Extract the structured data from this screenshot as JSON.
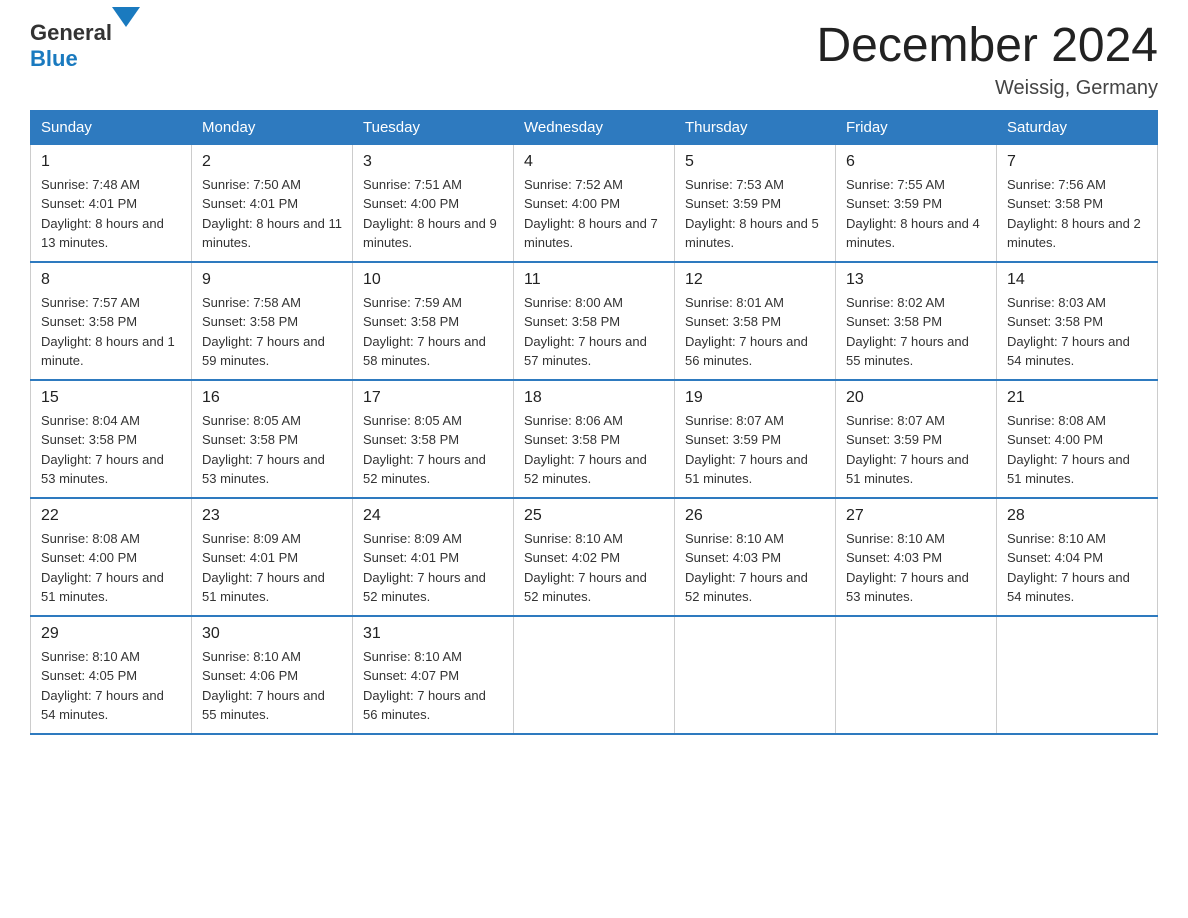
{
  "header": {
    "logo_general": "General",
    "logo_blue": "Blue",
    "month_title": "December 2024",
    "location": "Weissig, Germany"
  },
  "days_of_week": [
    "Sunday",
    "Monday",
    "Tuesday",
    "Wednesday",
    "Thursday",
    "Friday",
    "Saturday"
  ],
  "weeks": [
    [
      {
        "day": "1",
        "sunrise": "7:48 AM",
        "sunset": "4:01 PM",
        "daylight": "8 hours and 13 minutes."
      },
      {
        "day": "2",
        "sunrise": "7:50 AM",
        "sunset": "4:01 PM",
        "daylight": "8 hours and 11 minutes."
      },
      {
        "day": "3",
        "sunrise": "7:51 AM",
        "sunset": "4:00 PM",
        "daylight": "8 hours and 9 minutes."
      },
      {
        "day": "4",
        "sunrise": "7:52 AM",
        "sunset": "4:00 PM",
        "daylight": "8 hours and 7 minutes."
      },
      {
        "day": "5",
        "sunrise": "7:53 AM",
        "sunset": "3:59 PM",
        "daylight": "8 hours and 5 minutes."
      },
      {
        "day": "6",
        "sunrise": "7:55 AM",
        "sunset": "3:59 PM",
        "daylight": "8 hours and 4 minutes."
      },
      {
        "day": "7",
        "sunrise": "7:56 AM",
        "sunset": "3:58 PM",
        "daylight": "8 hours and 2 minutes."
      }
    ],
    [
      {
        "day": "8",
        "sunrise": "7:57 AM",
        "sunset": "3:58 PM",
        "daylight": "8 hours and 1 minute."
      },
      {
        "day": "9",
        "sunrise": "7:58 AM",
        "sunset": "3:58 PM",
        "daylight": "7 hours and 59 minutes."
      },
      {
        "day": "10",
        "sunrise": "7:59 AM",
        "sunset": "3:58 PM",
        "daylight": "7 hours and 58 minutes."
      },
      {
        "day": "11",
        "sunrise": "8:00 AM",
        "sunset": "3:58 PM",
        "daylight": "7 hours and 57 minutes."
      },
      {
        "day": "12",
        "sunrise": "8:01 AM",
        "sunset": "3:58 PM",
        "daylight": "7 hours and 56 minutes."
      },
      {
        "day": "13",
        "sunrise": "8:02 AM",
        "sunset": "3:58 PM",
        "daylight": "7 hours and 55 minutes."
      },
      {
        "day": "14",
        "sunrise": "8:03 AM",
        "sunset": "3:58 PM",
        "daylight": "7 hours and 54 minutes."
      }
    ],
    [
      {
        "day": "15",
        "sunrise": "8:04 AM",
        "sunset": "3:58 PM",
        "daylight": "7 hours and 53 minutes."
      },
      {
        "day": "16",
        "sunrise": "8:05 AM",
        "sunset": "3:58 PM",
        "daylight": "7 hours and 53 minutes."
      },
      {
        "day": "17",
        "sunrise": "8:05 AM",
        "sunset": "3:58 PM",
        "daylight": "7 hours and 52 minutes."
      },
      {
        "day": "18",
        "sunrise": "8:06 AM",
        "sunset": "3:58 PM",
        "daylight": "7 hours and 52 minutes."
      },
      {
        "day": "19",
        "sunrise": "8:07 AM",
        "sunset": "3:59 PM",
        "daylight": "7 hours and 51 minutes."
      },
      {
        "day": "20",
        "sunrise": "8:07 AM",
        "sunset": "3:59 PM",
        "daylight": "7 hours and 51 minutes."
      },
      {
        "day": "21",
        "sunrise": "8:08 AM",
        "sunset": "4:00 PM",
        "daylight": "7 hours and 51 minutes."
      }
    ],
    [
      {
        "day": "22",
        "sunrise": "8:08 AM",
        "sunset": "4:00 PM",
        "daylight": "7 hours and 51 minutes."
      },
      {
        "day": "23",
        "sunrise": "8:09 AM",
        "sunset": "4:01 PM",
        "daylight": "7 hours and 51 minutes."
      },
      {
        "day": "24",
        "sunrise": "8:09 AM",
        "sunset": "4:01 PM",
        "daylight": "7 hours and 52 minutes."
      },
      {
        "day": "25",
        "sunrise": "8:10 AM",
        "sunset": "4:02 PM",
        "daylight": "7 hours and 52 minutes."
      },
      {
        "day": "26",
        "sunrise": "8:10 AM",
        "sunset": "4:03 PM",
        "daylight": "7 hours and 52 minutes."
      },
      {
        "day": "27",
        "sunrise": "8:10 AM",
        "sunset": "4:03 PM",
        "daylight": "7 hours and 53 minutes."
      },
      {
        "day": "28",
        "sunrise": "8:10 AM",
        "sunset": "4:04 PM",
        "daylight": "7 hours and 54 minutes."
      }
    ],
    [
      {
        "day": "29",
        "sunrise": "8:10 AM",
        "sunset": "4:05 PM",
        "daylight": "7 hours and 54 minutes."
      },
      {
        "day": "30",
        "sunrise": "8:10 AM",
        "sunset": "4:06 PM",
        "daylight": "7 hours and 55 minutes."
      },
      {
        "day": "31",
        "sunrise": "8:10 AM",
        "sunset": "4:07 PM",
        "daylight": "7 hours and 56 minutes."
      },
      null,
      null,
      null,
      null
    ]
  ],
  "labels": {
    "sunrise": "Sunrise:",
    "sunset": "Sunset:",
    "daylight": "Daylight:"
  }
}
